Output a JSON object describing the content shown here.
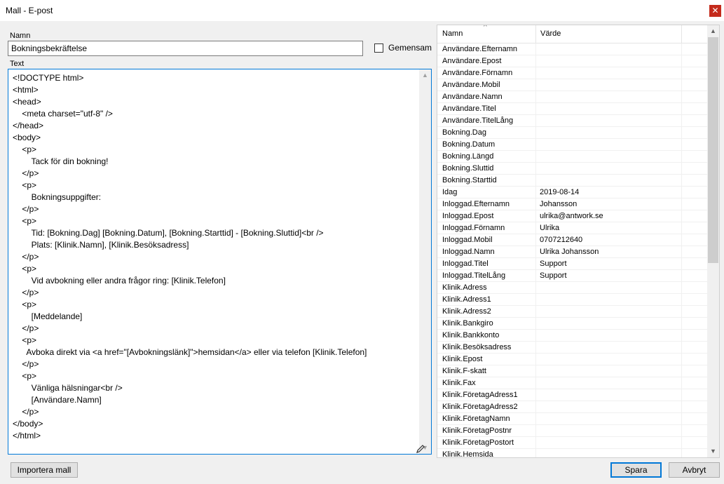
{
  "window": {
    "title": "Mall - E-post",
    "close": "✕"
  },
  "form": {
    "name_label": "Namn",
    "name_value": "Bokningsbekräftelse",
    "shared_label": "Gemensam",
    "shared_checked": false,
    "text_label": "Text",
    "text_lines": [
      "<!DOCTYPE html>",
      "<html>",
      "<head>",
      "    <meta charset=\"utf-8\" />",
      "</head>",
      "<body>",
      "    <p>",
      "        Tack för din bokning!",
      "    </p>",
      "    <p>",
      "        Bokningsuppgifter:",
      "    </p>",
      "    <p>",
      "        Tid: [Bokning.Dag] [Bokning.Datum], [Bokning.Starttid] - [Bokning.Sluttid]<br />",
      "        Plats: [Klinik.Namn], [Klinik.Besöksadress]",
      "    </p>",
      "    <p>",
      "        Vid avbokning eller andra frågor ring: [Klinik.Telefon]",
      "    </p>",
      "    <p>",
      "        [Meddelande]",
      "    </p>",
      "    <p>",
      "      Avboka direkt via <a href=\"[Avbokningslänk]\">hemsidan</a> eller via telefon [Klinik.Telefon]",
      "    </p>",
      "    <p>",
      "        Vänliga hälsningar<br />",
      "        [Användare.Namn]",
      "    </p>",
      "</body>",
      "</html>"
    ]
  },
  "variables": {
    "columns": {
      "name": "Namn",
      "value": "Värde"
    },
    "sort_glyph": "^",
    "rows": [
      {
        "name": "Användare.Efternamn",
        "value": ""
      },
      {
        "name": "Användare.Epost",
        "value": ""
      },
      {
        "name": "Användare.Förnamn",
        "value": ""
      },
      {
        "name": "Användare.Mobil",
        "value": ""
      },
      {
        "name": "Användare.Namn",
        "value": ""
      },
      {
        "name": "Användare.Titel",
        "value": ""
      },
      {
        "name": "Användare.TitelLång",
        "value": ""
      },
      {
        "name": "Bokning.Dag",
        "value": ""
      },
      {
        "name": "Bokning.Datum",
        "value": ""
      },
      {
        "name": "Bokning.Längd",
        "value": ""
      },
      {
        "name": "Bokning.Sluttid",
        "value": ""
      },
      {
        "name": "Bokning.Starttid",
        "value": ""
      },
      {
        "name": "Idag",
        "value": "2019-08-14"
      },
      {
        "name": "Inloggad.Efternamn",
        "value": "Johansson"
      },
      {
        "name": "Inloggad.Epost",
        "value": "ulrika@antwork.se"
      },
      {
        "name": "Inloggad.Förnamn",
        "value": "Ulrika"
      },
      {
        "name": "Inloggad.Mobil",
        "value": "0707212640"
      },
      {
        "name": "Inloggad.Namn",
        "value": "Ulrika Johansson"
      },
      {
        "name": "Inloggad.Titel",
        "value": "Support"
      },
      {
        "name": "Inloggad.TitelLång",
        "value": "Support"
      },
      {
        "name": "Klinik.Adress",
        "value": ""
      },
      {
        "name": "Klinik.Adress1",
        "value": ""
      },
      {
        "name": "Klinik.Adress2",
        "value": ""
      },
      {
        "name": "Klinik.Bankgiro",
        "value": ""
      },
      {
        "name": "Klinik.Bankkonto",
        "value": ""
      },
      {
        "name": "Klinik.Besöksadress",
        "value": ""
      },
      {
        "name": "Klinik.Epost",
        "value": ""
      },
      {
        "name": "Klinik.F-skatt",
        "value": ""
      },
      {
        "name": "Klinik.Fax",
        "value": ""
      },
      {
        "name": "Klinik.FöretagAdress1",
        "value": ""
      },
      {
        "name": "Klinik.FöretagAdress2",
        "value": ""
      },
      {
        "name": "Klinik.FöretagNamn",
        "value": ""
      },
      {
        "name": "Klinik.FöretagPostnr",
        "value": ""
      },
      {
        "name": "Klinik.FöretagPostort",
        "value": ""
      },
      {
        "name": "Klinik.Hemsida",
        "value": ""
      }
    ]
  },
  "buttons": {
    "import": "Importera mall",
    "save": "Spara",
    "cancel": "Avbryt"
  },
  "icons": {
    "close": "close-icon",
    "pen": "pen-icon",
    "scroll_up": "scroll-up-icon",
    "scroll_down": "scroll-down-icon"
  },
  "colors": {
    "focus_border": "#0078d7",
    "close_bg": "#c42b1c"
  }
}
